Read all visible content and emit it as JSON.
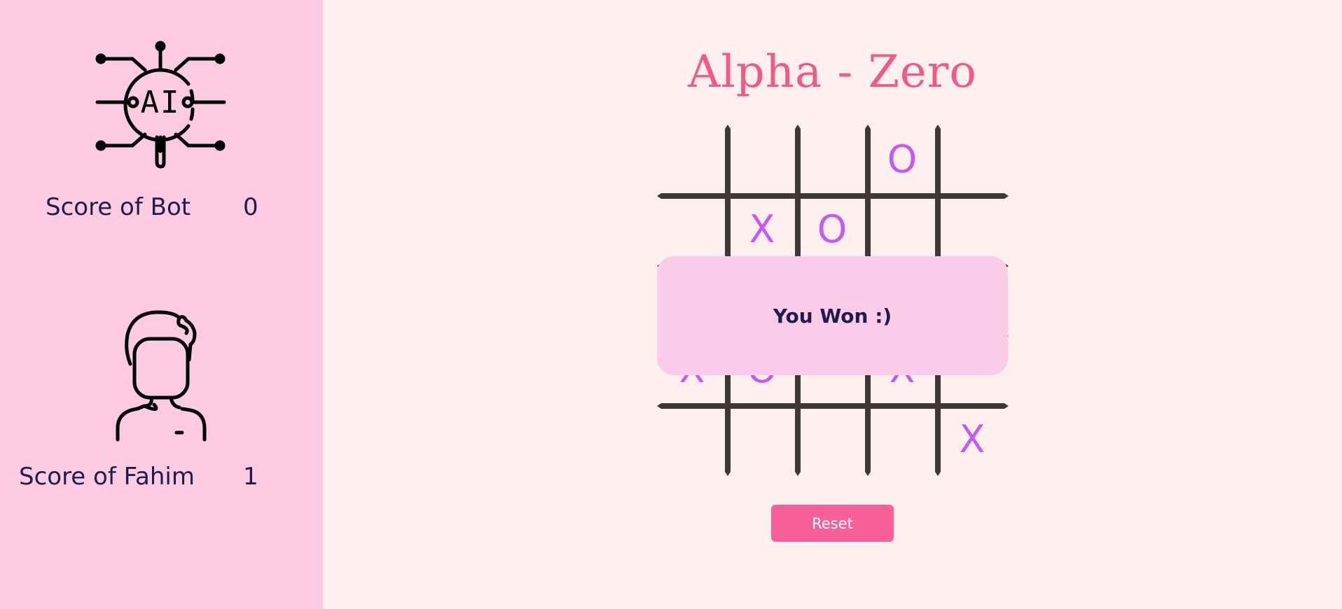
{
  "bot": {
    "score_label": "Score of Bot",
    "score_value": "0",
    "icon": "ai-chip-icon",
    "icon_text": "AI"
  },
  "human": {
    "score_label": "Score of Fahim",
    "score_value": "1",
    "icon": "user-avatar-icon"
  },
  "title": "Alpha - Zero",
  "board": {
    "rows": 5,
    "cols": 5,
    "cells": [
      [
        "",
        "",
        "",
        "O",
        ""
      ],
      [
        "",
        "X",
        "O",
        "",
        ""
      ],
      [
        "",
        "",
        "",
        "",
        ""
      ],
      [
        "X",
        "O",
        "",
        "X",
        ""
      ],
      [
        "",
        "",
        "",
        "",
        "X"
      ]
    ]
  },
  "result_message": "You Won :)",
  "reset_label": "Reset",
  "colors": {
    "sidebar_bg": "#fccbe2",
    "page_bg": "#fcefee",
    "title": "#f05a89",
    "grid_line": "#3f3838",
    "mark": "#c45af0",
    "modal_bg": "#fdcbea",
    "button_bg": "#f8609a",
    "text_dark": "#1f1b4d"
  }
}
